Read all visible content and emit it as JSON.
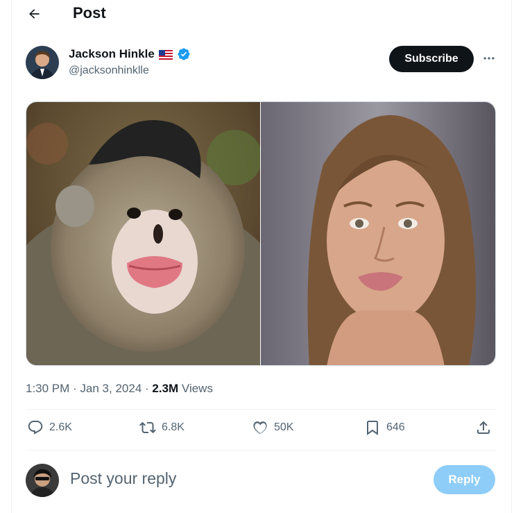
{
  "header": {
    "title": "Post",
    "back_icon": "arrow-left-icon"
  },
  "author": {
    "name": "Jackson Hinkle",
    "flag": "🇺🇸",
    "handle": "@jacksonhinklle",
    "verified_icon": "verified-badge-icon"
  },
  "subscribe_label": "Subscribe",
  "more_icon": "more-dots-icon",
  "meta": {
    "time_date": "1:30 PM · Jan 3, 2024 · ",
    "views_count": "2.3M",
    "views_label": " Views"
  },
  "actions": {
    "replies": "2.6K",
    "reposts": "6.8K",
    "likes": "50K",
    "bookmarks": "646"
  },
  "reply": {
    "placeholder": "Post your reply",
    "button_label": "Reply"
  },
  "colors": {
    "accent": "#1d9bf0",
    "reply_button": "#8ecdf8",
    "muted": "#536471",
    "text": "#0f1419"
  }
}
